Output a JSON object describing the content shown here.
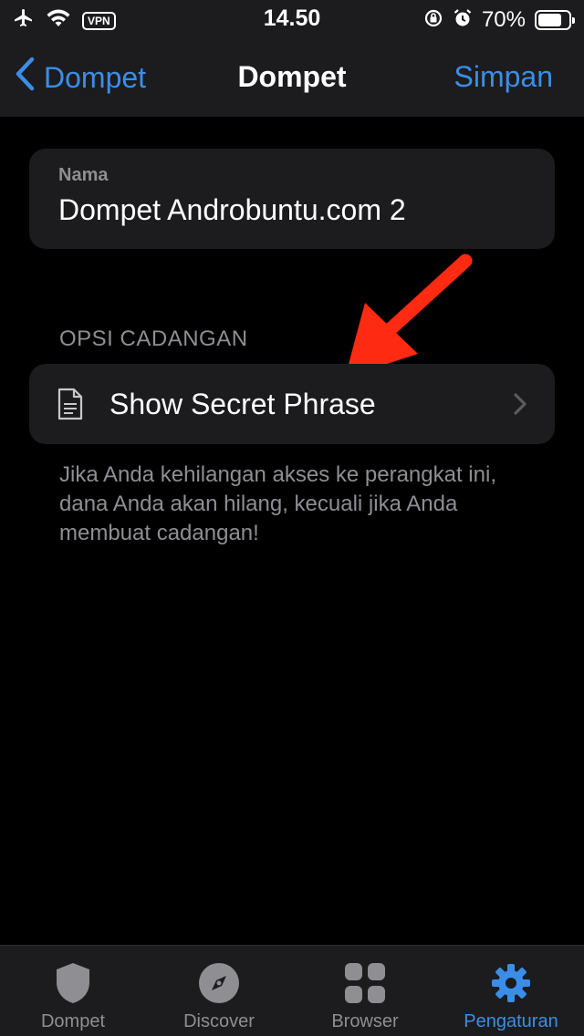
{
  "status_bar": {
    "time": "14.50",
    "vpn": "VPN",
    "battery": "70%"
  },
  "nav": {
    "back_label": "Dompet",
    "title": "Dompet",
    "save_label": "Simpan"
  },
  "name_field": {
    "label": "Nama",
    "value": "Dompet Androbuntu.com 2"
  },
  "backup_section": {
    "header": "OPSI CADANGAN",
    "row_label": "Show Secret Phrase",
    "row_icon": "document-icon",
    "footnote": "Jika Anda kehilangan akses ke perangkat ini, dana Anda akan hilang, kecuali jika Anda membuat cadangan!"
  },
  "tabs": [
    {
      "label": "Dompet",
      "icon": "shield-icon",
      "active": false
    },
    {
      "label": "Discover",
      "icon": "compass-icon",
      "active": false
    },
    {
      "label": "Browser",
      "icon": "grid-icon",
      "active": false
    },
    {
      "label": "Pengaturan",
      "icon": "gear-icon",
      "active": true
    }
  ],
  "colors": {
    "accent": "#3b8ee8",
    "background": "#000000",
    "card": "#1c1c1e",
    "secondary_text": "#8e8e93",
    "annotation_arrow": "#ff2a12"
  }
}
